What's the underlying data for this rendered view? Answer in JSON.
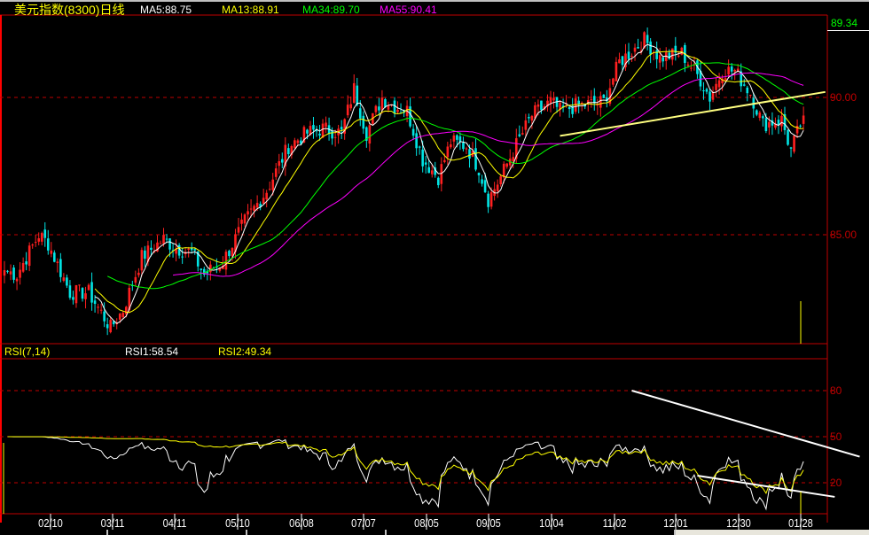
{
  "header": {
    "title": "美元指数(8300)日线",
    "ma5": "MA5:88.75",
    "ma13": "MA13:88.91",
    "ma34": "MA34:89.70",
    "ma55": "MA55:90.41",
    "last_price": "89.34"
  },
  "rsi_header": {
    "title": "RSI(7,14)",
    "rsi1": "RSI1:58.54",
    "rsi2": "RSI2:49.34"
  },
  "colors": {
    "up": "#ff2020",
    "down": "#00e5e5",
    "ma5": "#ffffff",
    "ma13": "#ffff00",
    "ma34": "#00ff00",
    "ma55": "#ff00ff",
    "grid": "#c00000",
    "trend_price": "#ffff80",
    "trend_rsi": "#ffffff"
  },
  "chart_data": [
    {
      "type": "candlestick",
      "title": "美元指数(8300)日线",
      "ylim": [
        80.8,
        92.8
      ],
      "y_ticks": [
        "90.00",
        "85.00"
      ],
      "x_ticks": [
        "02/10",
        "03/11",
        "04/11",
        "05/10",
        "06/08",
        "07/07",
        "08/05",
        "09/05",
        "10/04",
        "11/02",
        "12/01",
        "12/30",
        "01/28"
      ],
      "close_waypoints": [
        [
          0,
          83.71
        ],
        [
          4,
          83.55
        ],
        [
          11,
          85.0
        ],
        [
          14,
          84.68
        ],
        [
          21,
          82.9
        ],
        [
          27,
          82.9
        ],
        [
          34,
          81.61
        ],
        [
          38,
          82.26
        ],
        [
          44,
          84.19
        ],
        [
          51,
          84.84
        ],
        [
          55,
          84.52
        ],
        [
          60,
          84.35
        ],
        [
          64,
          83.55
        ],
        [
          70,
          84.03
        ],
        [
          77,
          85.48
        ],
        [
          84,
          86.61
        ],
        [
          91,
          88.23
        ],
        [
          97,
          88.71
        ],
        [
          102,
          88.87
        ],
        [
          108,
          88.71
        ],
        [
          112,
          90.32
        ],
        [
          116,
          88.71
        ],
        [
          121,
          90.0
        ],
        [
          125,
          89.68
        ],
        [
          129,
          89.52
        ],
        [
          134,
          87.74
        ],
        [
          139,
          87.1
        ],
        [
          143,
          88.39
        ],
        [
          148,
          88.23
        ],
        [
          152,
          87.42
        ],
        [
          155,
          86.29
        ],
        [
          159,
          87.1
        ],
        [
          163,
          88.06
        ],
        [
          169,
          89.35
        ],
        [
          175,
          89.84
        ],
        [
          178,
          89.52
        ],
        [
          183,
          89.68
        ],
        [
          192,
          89.84
        ],
        [
          197,
          91.29
        ],
        [
          205,
          92.1
        ],
        [
          210,
          91.45
        ],
        [
          217,
          91.61
        ],
        [
          223,
          90.65
        ],
        [
          226,
          90.0
        ],
        [
          230,
          90.97
        ],
        [
          234,
          90.97
        ],
        [
          239,
          90.16
        ],
        [
          243,
          89.03
        ],
        [
          249,
          89.19
        ],
        [
          252,
          88.06
        ],
        [
          256,
          89.34
        ]
      ],
      "moving_averages": [
        5,
        13,
        34,
        55
      ],
      "trendline": [
        [
          178,
          88.6
        ],
        [
          263,
          90.2
        ]
      ]
    },
    {
      "type": "line",
      "title": "RSI(7,14)",
      "series": [
        {
          "name": "RSI1",
          "period": 7
        },
        {
          "name": "RSI2",
          "period": 14
        }
      ],
      "ylim": [
        0,
        100
      ],
      "y_ticks": [
        "80",
        "50",
        "20"
      ],
      "trendlines": [
        [
          [
            201,
            80
          ],
          [
            274,
            37
          ]
        ],
        [
          [
            222,
            24.6
          ],
          [
            266,
            10.8
          ]
        ]
      ]
    }
  ]
}
